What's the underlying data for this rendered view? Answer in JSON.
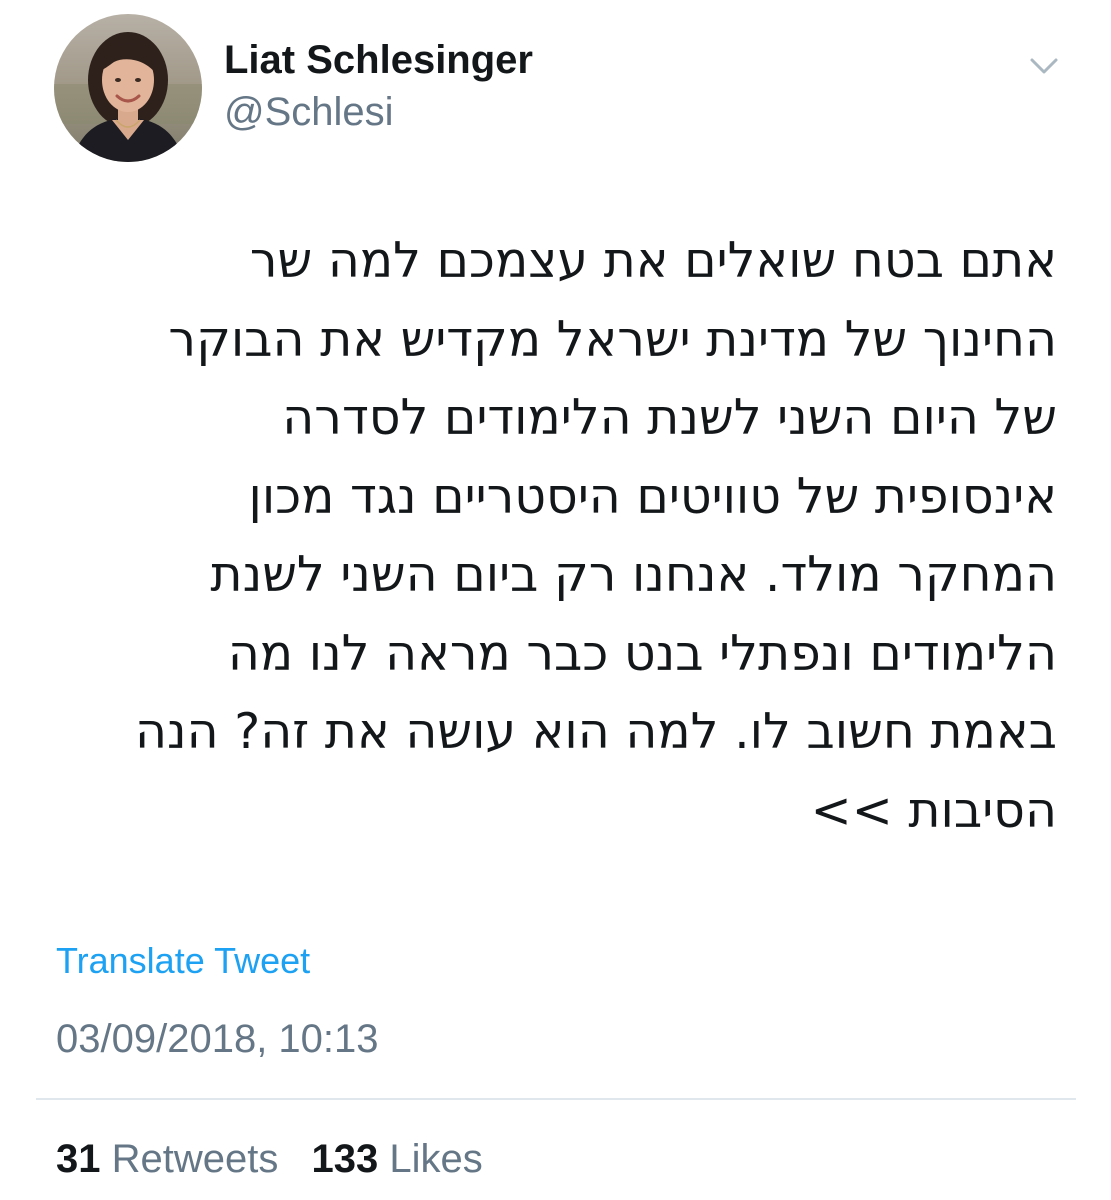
{
  "author": {
    "display_name": "Liat Schlesinger",
    "handle": "@Schlesi"
  },
  "tweet": {
    "text_lines": [
      "אתם בטח שואלים את עצמכם למה שר",
      "החינוך של מדינת ישראל מקדיש את הבוקר",
      "של היום השני לשנת הלימודים לסדרה",
      "אינסופית של טוויטים היסטריים נגד מכון",
      "המחקר מולד. אנחנו רק ביום השני לשנת",
      "הלימודים ונפתלי בנט כבר מראה לנו מה",
      "באמת חשוב לו. למה הוא עושה את זה? הנה",
      "הסיבות >>"
    ],
    "translate_label": "Translate Tweet",
    "timestamp": "03/09/2018, 10:13"
  },
  "stats": {
    "retweets_count": "31",
    "retweets_label": "Retweets",
    "likes_count": "133",
    "likes_label": "Likes"
  },
  "icons": {
    "menu": "chevron-down-icon"
  },
  "colors": {
    "text": "#14171a",
    "secondary": "#657786",
    "link": "#1da1f2",
    "divider": "#e1e8ed"
  }
}
